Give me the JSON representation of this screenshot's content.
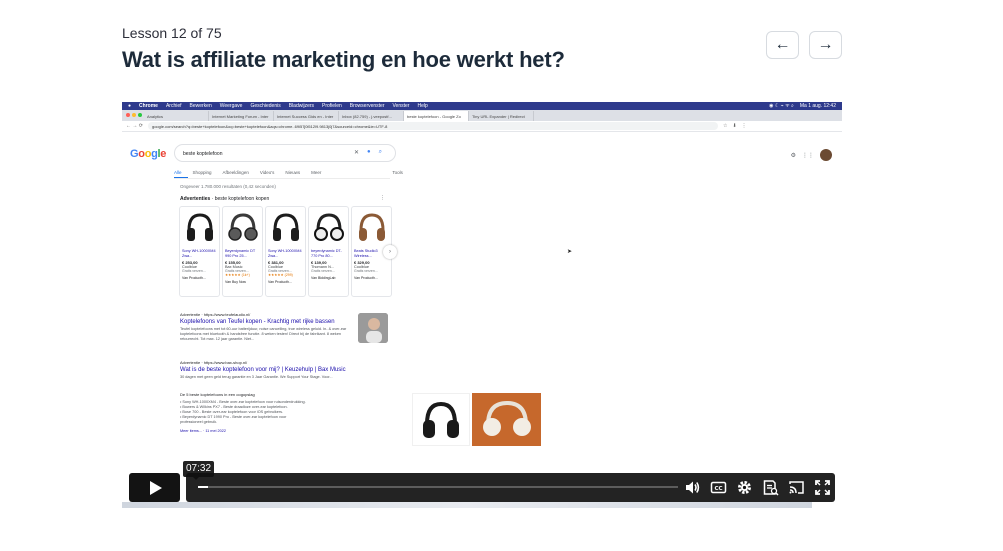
{
  "header": {
    "lesson_label": "Lesson 12 of 75",
    "title": "Wat is affiliate marketing en hoe werkt het?",
    "prev_symbol": "←",
    "next_symbol": "→"
  },
  "screen": {
    "mac_menu": [
      "Chrome",
      "Archief",
      "Bewerken",
      "Weergave",
      "Geschiedenis",
      "Bladwijzers",
      "Profielen",
      "Browservenster",
      "Venster",
      "Help"
    ],
    "clock": "Ma 1 aug. 12:42",
    "tabs": [
      "Analytics",
      "Internet Marketing Forum - Inter",
      "Internet Success Gids en - Inter",
      "Inbox (82.759) - j.veepostf...",
      "beste koptelefoon - Google Zo",
      "Tiny URL Expander | Redirect"
    ],
    "address": "google.com/search?q=beste+koptelefoon&oq=beste+koptelefoon&aqs=chrome..69i57j0i512l9.9813j0j7&sourceid=chrome&ie=UTF-8",
    "google": {
      "logo": "Google",
      "query": "beste koptelefoon",
      "tabs": [
        "Alle",
        "Shopping",
        "Afbeeldingen",
        "Video's",
        "Nieuws",
        "Meer",
        "Tools"
      ],
      "stats": "Ongeveer 1.780.000 resultaten (0,42 seconden)",
      "ads_label": "Advertenties",
      "ads_title": "· beste koptelefoon kopen",
      "products": [
        {
          "name": "Sony WH-1000XM4 Zwa...",
          "price": "€ 253,00",
          "store": "Coolblue",
          "sub": "Gratis verzen...",
          "rating": "",
          "link": "Van Producth..."
        },
        {
          "name": "Beyerdynamic DT 990 Pro 25...",
          "price": "€ 155,00",
          "store": "Bax Music",
          "sub": "Gratis verzen...",
          "rating": "★★★★★ (1k+)",
          "link": "Van Buy Now"
        },
        {
          "name": "Sony WH-1000XM4 Zwa...",
          "price": "€ 381,00",
          "store": "Coolblue",
          "sub": "Gratis verzen...",
          "rating": "★★★★★ (299)",
          "link": "Van Producth..."
        },
        {
          "name": "beyerdynamic DT-770 Pro 80...",
          "price": "€ 139,00",
          "store": "Thomann N...",
          "sub": "Gratis verzen...",
          "rating": "",
          "link": "Van BiddingLab"
        },
        {
          "name": "Beats Studio3 Wireless...",
          "price": "€ 329,00",
          "store": "Coolblue",
          "sub": "Gratis verzen...",
          "rating": "",
          "link": "Van Producth..."
        }
      ],
      "result1": {
        "source": "Advertentie · https://www.teufelaudio.nl/",
        "title": "Koptelefoons van Teufel kopen - Krachtig met rijke bassen",
        "desc": "Teufel koptelefoons met tot 60-uur batterijduur, noise cancelling, true wireless geluid. In- & over-ear koptelefoons met bluetooth & handsfree functie. 8 weken testen! Direct bij de fabrikant. 8 weken retourrecht. Tot max. 12 jaar garantie. Niet..."
      },
      "result2": {
        "source": "Advertentie · https://www.bax-shop.nl/",
        "title": "Wat is de beste koptelefoon voor mij? | Keuzehulp | Bax Music",
        "desc": "30 dagen met geen geld terug garantie en 3 Jaar Garantie. We Support Your Stage. Voor..."
      },
      "list_heading": "De 5 beste koptelefoons in een oogopslag",
      "list_items": [
        "• Sony WH-1000XM4 - Beste over-ear koptelefoon voor ruisonderdrukking.",
        "• Bowers & Wilkins PX7 - Beste draadloze over-ear koptelefoon.",
        "• Bose 700 - Beste over-ear koptelefoon voor iOS gebruikers.",
        "• Beyerdynamic DT 1990 Pro - Beste over-ear koptelefoon voor",
        "  professioneel gebruik."
      ],
      "list_more": "Meer items... · 11 mei 2022"
    }
  },
  "player": {
    "timestamp": "07:32",
    "progress": 0.02
  }
}
